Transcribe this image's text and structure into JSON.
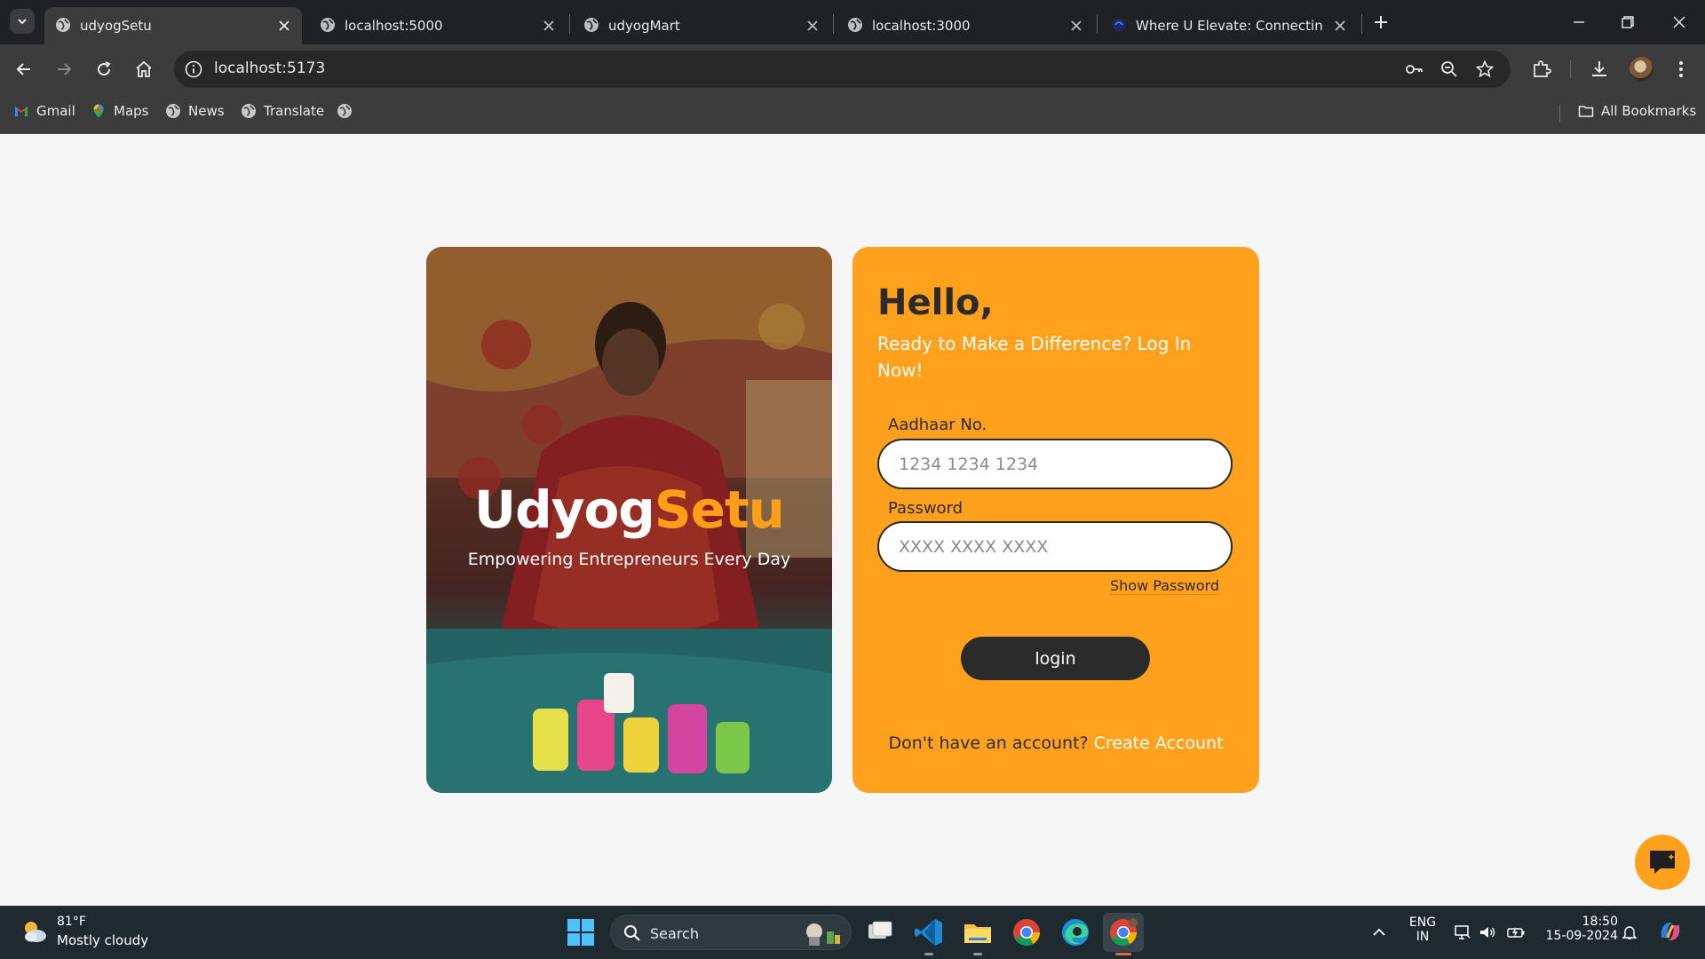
{
  "browser": {
    "tabs": [
      {
        "title": "udyogSetu",
        "active": true
      },
      {
        "title": "localhost:5000",
        "active": false
      },
      {
        "title": "udyogMart",
        "active": false
      },
      {
        "title": "localhost:3000",
        "active": false
      },
      {
        "title": "Where U Elevate: Connecting ne",
        "active": false
      }
    ],
    "url": "localhost:5173",
    "bookmarks": [
      "Gmail",
      "Maps",
      "News",
      "Translate"
    ],
    "all_bookmarks_label": "All Bookmarks"
  },
  "hero": {
    "brand_part1": "Udyog",
    "brand_part2": "Setu",
    "tagline": "Empowering Entrepreneurs Every Day"
  },
  "login": {
    "greeting": "Hello,",
    "subtitle": "Ready to Make a Difference? Log In Now!",
    "aadhaar_label": "Aadhaar No.",
    "aadhaar_placeholder": "1234 1234 1234",
    "password_label": "Password",
    "password_placeholder": "XXXX XXXX XXXX",
    "show_password": "Show Password",
    "login_button": "login",
    "no_account_text": "Don't have an account?",
    "create_account_link": "Create Account"
  },
  "taskbar": {
    "weather_temp": "81°F",
    "weather_desc": "Mostly cloudy",
    "search_label": "Search",
    "language": "ENG",
    "region": "IN",
    "time": "18:50",
    "date": "15-09-2024"
  },
  "colors": {
    "accent_orange": "#ffa11c",
    "dark_text": "#2b2b2b",
    "browser_bg": "#3c3c3c",
    "taskbar_bg": "#1f2a30"
  }
}
